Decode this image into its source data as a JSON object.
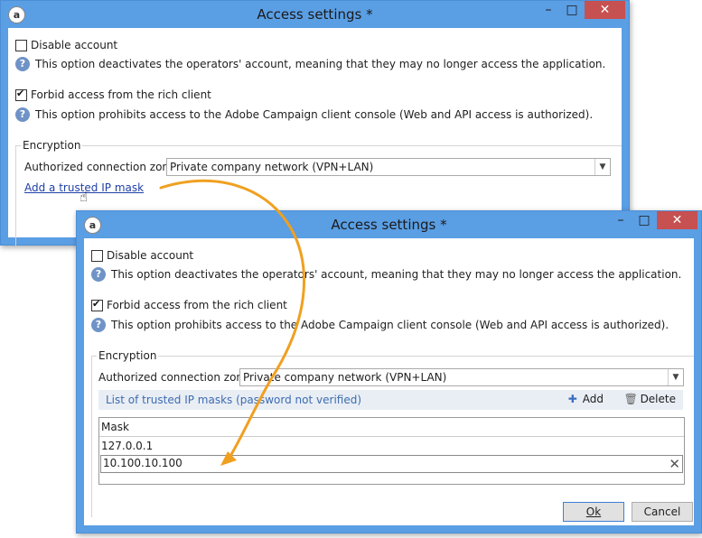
{
  "window1": {
    "title": "Access settings *",
    "disable_account": "Disable account",
    "disable_account_help": "This option deactivates the operators' account, meaning that they may no longer access the application.",
    "forbid_rich_client": "Forbid access from the rich client",
    "forbid_rich_client_help": "This option prohibits access to the Adobe Campaign client console (Web and API access is authorized).",
    "encryption_label": "Encryption",
    "zone_label": "Authorized connection zone:",
    "zone_value": "Private company network (VPN+LAN)",
    "add_mask_link": "Add a trusted IP mask"
  },
  "window2": {
    "title": "Access settings *",
    "disable_account": "Disable account",
    "disable_account_help": "This option deactivates the operators' account, meaning that they may no longer access the application.",
    "forbid_rich_client": "Forbid access from the rich client",
    "forbid_rich_client_help": "This option prohibits access to the Adobe Campaign client console (Web and API access is authorized).",
    "encryption_label": "Encryption",
    "zone_label": "Authorized connection zone:",
    "zone_value": "Private company network (VPN+LAN)",
    "list_title": "List of trusted IP masks (password not verified)",
    "add_label": "Add",
    "delete_label": "Delete",
    "grid_header": "Mask",
    "masks": [
      "127.0.0.1",
      "10.100.10.100"
    ],
    "ok_label": "Ok",
    "cancel_label": "Cancel"
  },
  "colors": {
    "titlebar": "#5a9ee4",
    "close_button": "#c75050",
    "link": "#1f3fa8",
    "arrow": "#f0a020"
  },
  "icons": [
    "app-icon",
    "minimize-icon",
    "maximize-icon",
    "close-icon",
    "help-icon",
    "checkbox-icon",
    "hand-cursor-icon",
    "add-icon",
    "trash-icon",
    "clear-icon",
    "dropdown-arrow-icon",
    "curved-arrow-icon"
  ]
}
